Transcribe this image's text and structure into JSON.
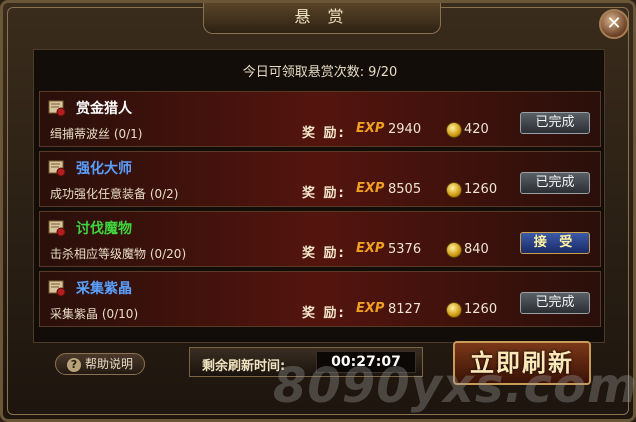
{
  "window": {
    "title": "悬 赏",
    "close_glyph": "✕"
  },
  "counter": {
    "label": "今日可领取悬赏次数:",
    "value": "9/20"
  },
  "quests": [
    {
      "name": "赏金猎人",
      "name_color": "#ffffff",
      "desc": "缉捕蒂波丝 (0/1)",
      "reward_label": "奖 励:",
      "exp_label": "EXP",
      "exp": "2940",
      "gold": "420",
      "button": "已完成",
      "status": "done"
    },
    {
      "name": "强化大师",
      "name_color": "#5aa0ff",
      "desc": "成功强化任意装备 (0/2)",
      "reward_label": "奖 励:",
      "exp_label": "EXP",
      "exp": "8505",
      "gold": "1260",
      "button": "已完成",
      "status": "done"
    },
    {
      "name": "讨伐魔物",
      "name_color": "#3fd43f",
      "desc": "击杀相应等级魔物 (0/20)",
      "reward_label": "奖 励:",
      "exp_label": "EXP",
      "exp": "5376",
      "gold": "840",
      "button": "接 受",
      "status": "accept"
    },
    {
      "name": "采集紫晶",
      "name_color": "#5aa0ff",
      "desc": "采集紫晶 (0/10)",
      "reward_label": "奖 励:",
      "exp_label": "EXP",
      "exp": "8127",
      "gold": "1260",
      "button": "已完成",
      "status": "done"
    }
  ],
  "footer": {
    "help_icon": "?",
    "help_label": "帮助说明",
    "timer_label": "剩余刷新时间:",
    "timer_value": "00:27:07",
    "refresh_label": "立即刷新"
  },
  "watermark": "8090yxs.com"
}
